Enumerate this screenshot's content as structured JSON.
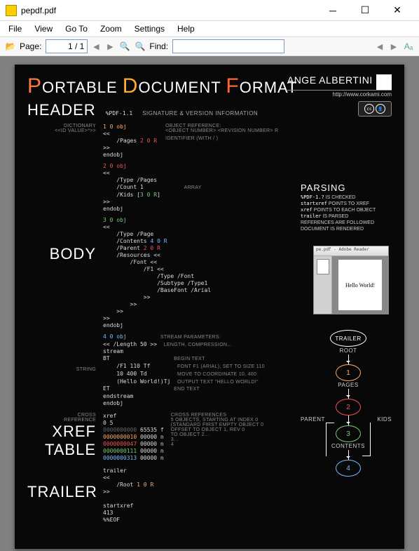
{
  "window": {
    "title": "pepdf.pdf"
  },
  "menubar": [
    "File",
    "View",
    "Go To",
    "Zoom",
    "Settings",
    "Help"
  ],
  "toolbar": {
    "page_label": "Page:",
    "page_value": "1 / 1",
    "find_label": "Find:",
    "find_value": ""
  },
  "doc": {
    "title": {
      "p": "P",
      "ortable": "ORTABLE ",
      "d": "D",
      "ocument": "OCUMENT ",
      "f": "F",
      "ormat": "ORMAT"
    },
    "author": {
      "name": "ANGE ALBERTINI",
      "url": "http://www.corkami.com"
    },
    "cc": {
      "cc": "cc",
      "by": "BY"
    },
    "header": {
      "title": "HEADER",
      "sig": "%PDF-1.1",
      "sub": "SIGNATURE & VERSION INFORMATION",
      "dict_label": "DICTIONARY",
      "dict_hint": "<<ID VALUE>*>>",
      "objref_label": "OBJECT REFERENCE:",
      "objref_hint": "<OBJECT NUMBER> <REVISION NUMBER> R",
      "ident_label": "IDENTIFIER (WITH / )",
      "obj1": {
        "decl": "1 0 obj",
        "body": "<<\n    /Pages 2 0 R\n>>\nendobj"
      }
    },
    "body": {
      "title": "BODY",
      "obj2": {
        "decl": "2 0 obj",
        "body": "<<\n    /Type /Pages\n    /Count 1\n    /Kids [3 0 R]\n>>\nendobj",
        "array_label": "ARRAY"
      },
      "obj3": {
        "decl": "3 0 obj",
        "body": "<<\n    /Type /Page\n    /Contents 4 0 R\n    /Parent 2 0 R\n    /Resources <<\n        /Font <<\n            /F1 <<\n                /Type /Font\n                /Subtype /Type1\n                /BaseFont /Arial\n            >>\n        >>\n    >>\n>>\nendobj"
      },
      "obj4": {
        "decl": "4 0 obj",
        "streamparams_label": "STREAM PARAMETERS:",
        "streamparams_hint": "LENGTH, COMPRESSION...",
        "body": "<< /Length 50 >>\nstream\nBT\n    /F1 110 Tf\n    10 400 Td\n    (Hello World!)Tj\nET\nendstream\nendobj",
        "string_label": "STRING",
        "text_exp": {
          "bt": "BEGIN TEXT",
          "tf": "FONT F1 (ARIAL), SET TO SIZE 110",
          "td": "MOVE TO COORDINATE 10, 400",
          "tj": "OUTPUT TEXT \"HELLO WORLD!\"",
          "et": "END TEXT"
        }
      }
    },
    "xref": {
      "title1": "XREF",
      "title2": "TABLE",
      "sub": "CROSS\nREFERENCE",
      "code": "xref\n0 5\n0000000000 65535 f\n0000000010 00000 n\n0000000047 00000 n\n0000000111 00000 n\n0000000313 00000 n",
      "exp": "CROSS REFERENCES\n5 OBJECTS, STARTING AT INDEX 0\n(STANDARD FIRST EMPTY OBJECT 0\nOFFSET TO OBJECT 1, REV 0\nTO OBJECT 2...\n3...\n4"
    },
    "trailer": {
      "title": "TRAILER",
      "code": "trailer\n<<\n    /Root 1 0 R\n>>\n\nstartxref\n413\n%%EOF"
    },
    "parsing": {
      "title": "PARSING",
      "lines": [
        {
          "pre": "%PDF-1.?",
          "post": " IS CHECKED"
        },
        {
          "pre": "startxref",
          "post": " POINTS TO XREF"
        },
        {
          "pre": "xref",
          "post": " POINTS TO EACH OBJECT"
        },
        {
          "pre": "trailer",
          "post": " IS PARSED"
        },
        {
          "pre": "",
          "post": "REFERENCES ARE FOLLOWED"
        },
        {
          "pre": "",
          "post": "DOCUMENT IS RENDERED"
        }
      ],
      "preview_title": "pe.pdf - Adobe Reader",
      "preview_text": "Hello World!"
    },
    "graph": {
      "trailer": "TRAILER",
      "root": "ROOT",
      "pages": "PAGES",
      "parent": "PARENT",
      "kids": "KIDS",
      "contents": "CONTENTS",
      "n1": "1",
      "n2": "2",
      "n3": "3",
      "n4": "4"
    }
  }
}
